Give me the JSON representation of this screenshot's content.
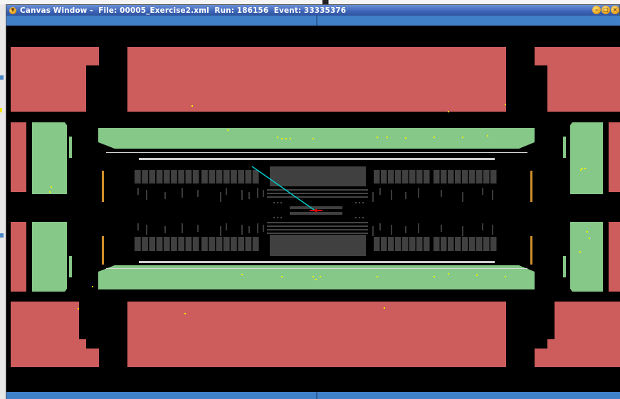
{
  "window": {
    "title": "Canvas Window -  File: 00005_Exercise2.xml  Run: 186156  Event: 33335376",
    "menu_icon": "window-menu-icon",
    "controls": [
      {
        "name": "minimize-icon",
        "glyph": "–"
      },
      {
        "name": "maximize-icon",
        "glyph": "□"
      },
      {
        "name": "close-icon",
        "glyph": "×"
      }
    ]
  },
  "colors": {
    "calorimeter_red": "#cd5c5c",
    "calorimeter_green": "#86c888",
    "tracker_gray": "#404040",
    "track_cyan": "#00c8c8",
    "vertex_red": "#e00000",
    "hit_yellow": "#f0f000",
    "frame_blue": "#3f80c8",
    "titlebar_blue": "#3c63b6"
  }
}
